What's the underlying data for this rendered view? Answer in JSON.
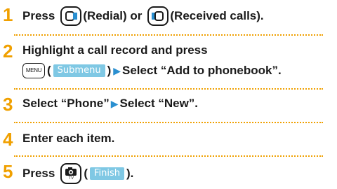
{
  "steps": [
    {
      "num": "1",
      "press": "Press",
      "redial": "(Redial) or",
      "received": "(Received calls)."
    },
    {
      "num": "2",
      "line1": "Highlight a call record and press",
      "menu_key": "MENU",
      "softkey": "Submenu",
      "select": "Select “Add to phonebook”."
    },
    {
      "num": "3",
      "part1": "Select “Phone”",
      "part2": "Select “New”."
    },
    {
      "num": "4",
      "text": "Enter each item."
    },
    {
      "num": "5",
      "press": "Press",
      "softkey": "Finish",
      "tv_label": "TV"
    }
  ],
  "colors": {
    "accent": "#f0a000",
    "softkey": "#7fc8e4",
    "arrow": "#2a8fd0"
  },
  "icons": [
    "redial-key-icon",
    "received-calls-key-icon",
    "menu-key-icon",
    "camera-key-icon",
    "arrow-right-icon"
  ]
}
